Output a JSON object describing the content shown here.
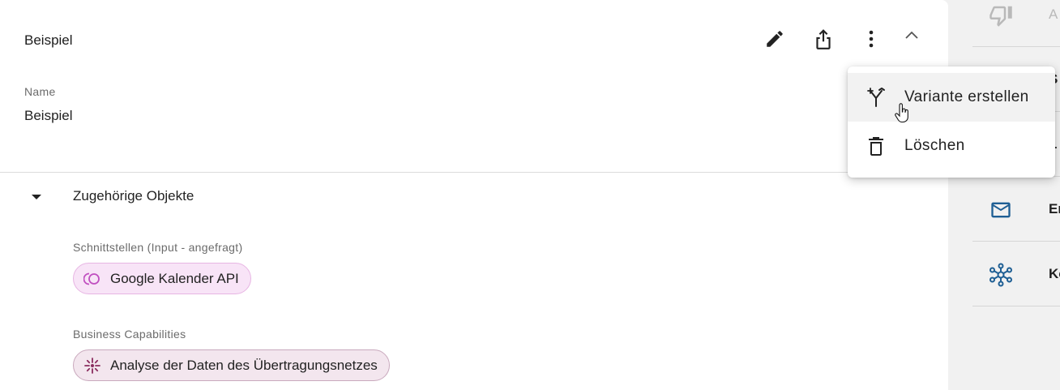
{
  "card": {
    "title": "Beispiel",
    "actions": {
      "edit_icon": "pencil-icon",
      "share_icon": "share-icon",
      "more_icon": "more-vertical-icon",
      "collapse_icon": "chevron-up-icon"
    },
    "name_label": "Name",
    "name_value": "Beispiel"
  },
  "related": {
    "title": "Zugehörige Objekte",
    "groups": [
      {
        "label": "Schnittstellen (Input - angefragt)",
        "chips": [
          {
            "label": "Google Kalender API",
            "icon": "interface-icon",
            "color": "#f8e4f7"
          }
        ]
      },
      {
        "label": "Business Capabilities",
        "chips": [
          {
            "label": "Analyse der Daten des Übertragungsnetzes",
            "icon": "capability-icon",
            "color": "#f3e6ee"
          }
        ]
      }
    ]
  },
  "menu": {
    "items": [
      {
        "label": "Variante erstellen",
        "icon": "fork-icon"
      },
      {
        "label": "Löschen",
        "icon": "trash-icon"
      }
    ]
  },
  "side_panel": {
    "items": [
      {
        "text": "A",
        "icon": "thumb-down-icon"
      },
      {
        "text": "S",
        "icon": ""
      },
      {
        "text": "L",
        "icon": ""
      },
      {
        "text": "Er",
        "icon": "mail-icon"
      },
      {
        "text": "Ko",
        "icon": "network-icon"
      }
    ]
  },
  "colors": {
    "accent_blue": "#1f5f94",
    "chip_icon_pink": "#c04fc0",
    "chip_icon_maroon": "#8a2c5e"
  }
}
